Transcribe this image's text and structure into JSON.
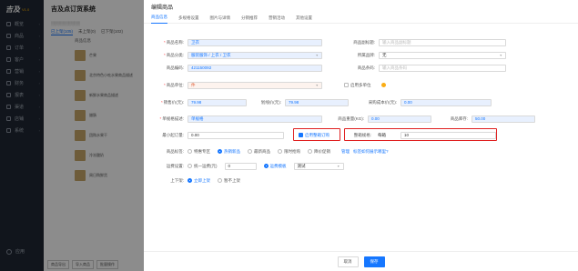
{
  "sidebar": {
    "logo": "吉及",
    "version": "V1.0",
    "items": [
      "概览",
      "商品",
      "订单",
      "客户",
      "营销",
      "财务",
      "报表",
      "渠道",
      "店铺",
      "系统"
    ],
    "footer": "应用"
  },
  "background": {
    "title": "吉及点订货系统",
    "tabs": [
      "已上架(105)",
      "未上架(0)",
      "已下架(102)"
    ],
    "column": "商品信息",
    "items": [
      "芒果",
      "北京特色小吃水果商品描述",
      "新鲜水果商品描述",
      "腊肠",
      "团购水果干",
      "冷冻酸奶",
      "周日购鲜货"
    ],
    "footer_buttons": [
      "商品导出",
      "导入商品",
      "批量操作"
    ]
  },
  "drawer": {
    "title": "编辑商品",
    "tabs": [
      "商品信息",
      "多规格设置",
      "图片与详情",
      "分销推荐",
      "营销活动",
      "其他设置"
    ],
    "form": {
      "name_label": "商品名称:",
      "name_value": "卫衣",
      "alias_label": "商品副标题:",
      "alias_placeholder": "输入商品副标题",
      "category_label": "商品分类:",
      "category_value": "服装服饰 / 上衣 / 卫衣",
      "brand_label": "所属品牌:",
      "brand_value": "无",
      "code_label": "商品编码:",
      "code_value": "421150092",
      "barcode_label": "商品条码:",
      "barcode_placeholder": "输入商品条码",
      "unit_label": "商品单位:",
      "unit_value": "件",
      "multi_unit_label": "启用多单位",
      "price_label": "销售价(元):",
      "price_value": "79.98",
      "cost_label": "划线价(元):",
      "cost_value": "79.98",
      "purchase_label": "采购成本价(元):",
      "purchase_value": "0.00",
      "spec_label": "单规格描述:",
      "spec_value": "单规格",
      "weight_label": "商品重量(KG):",
      "weight_value": "0.00",
      "stock_label": "商品库存:",
      "stock_value": "50.00",
      "moq_label": "最小起订量:",
      "moq_value": "0.00",
      "pack_check_label": "启用整箱订购",
      "pack_label": "整箱规格:",
      "pack_unit": "每箱",
      "pack_value": "10",
      "tags_label": "商品标签:",
      "tags": [
        "特惠专区",
        "热销新品",
        "最新商品",
        "限时抢购",
        "降价促销"
      ],
      "tags_link1": "管理",
      "tags_link2": "标签如何展示哪里?",
      "shipping_label": "运费设置:",
      "shipping_opts": [
        "统一运费(元)",
        "运费模板"
      ],
      "shipping_value": "0",
      "shipping_template": "测试",
      "shelf_label": "上下架:",
      "shelf_opts": [
        "立即上架",
        "暂不上架"
      ]
    },
    "footer": {
      "cancel": "取消",
      "save": "保存"
    }
  },
  "colors": {
    "accent": "#1677ff",
    "highlight": "#e02020",
    "sidebar": "#1f2733"
  }
}
